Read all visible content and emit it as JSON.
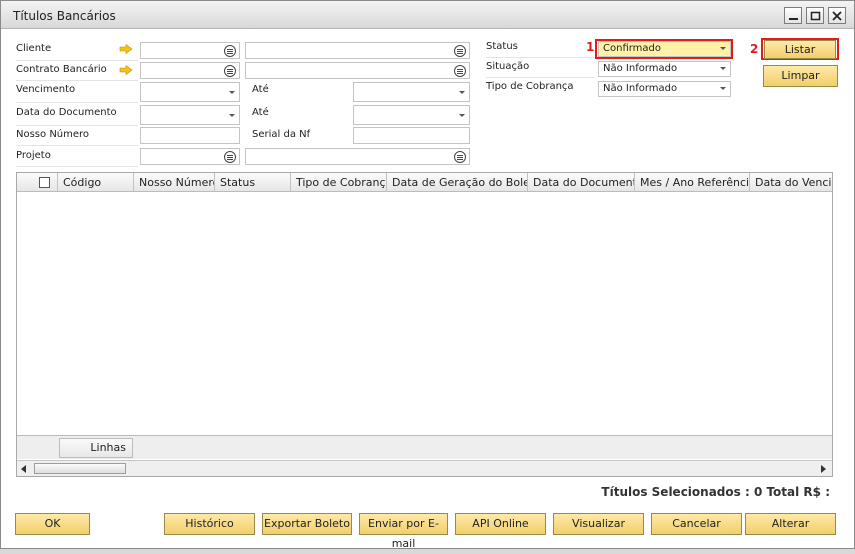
{
  "window": {
    "title": "Títulos Bancários"
  },
  "filters": {
    "cliente_label": "Cliente",
    "contrato_label": "Contrato Bancário",
    "vencimento_label": "Vencimento",
    "vencimento_ate_label": "Até",
    "data_documento_label": "Data do Documento",
    "data_documento_ate_label": "Até",
    "nosso_numero_label": "Nosso Número",
    "serial_nf_label": "Serial da Nf",
    "projeto_label": "Projeto"
  },
  "status_panel": {
    "status_label": "Status",
    "status_value": "Confirmado",
    "situacao_label": "Situação",
    "situacao_value": "Não Informado",
    "tipo_cobranca_label": "Tipo de Cobrança",
    "tipo_cobranca_value": "Não Informado"
  },
  "actions": {
    "listar": "Listar",
    "limpar": "Limpar"
  },
  "markers": {
    "one": "1",
    "two": "2"
  },
  "grid": {
    "columns": [
      "Código",
      "Nosso Número",
      "Status",
      "Tipo de Cobrança",
      "Data de Geração do Boleto",
      "Data do Documento",
      "Mes / Ano Referência",
      "Data do Vencime"
    ],
    "footer_label": "Linhas"
  },
  "summary": "Títulos Selecionados : 0 Total R$ :",
  "footer_buttons": {
    "ok": "OK",
    "historico": "Histórico",
    "exportar": "Exportar Boleto",
    "email": "Enviar por E-mail",
    "api": "API Online",
    "visualizar": "Visualizar",
    "cancelar": "Cancelar",
    "alterar": "Alterar"
  },
  "colors": {
    "accent_button": "#f3cf6a",
    "highlight_box": "#e21b1b",
    "status_field": "#fff2a8"
  }
}
